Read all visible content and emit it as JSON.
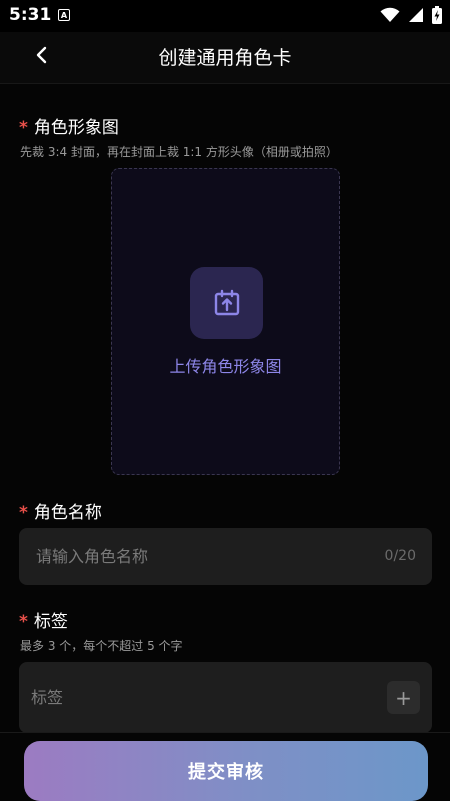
{
  "status_bar": {
    "time": "5:31",
    "app_icon_letter": "A",
    "icons": [
      "wifi-icon",
      "signal-icon",
      "battery-icon"
    ]
  },
  "header": {
    "back_icon": "chevron-left-icon",
    "title": "创建通用角色卡"
  },
  "avatar_section": {
    "required_mark": "*",
    "label": "角色形象图",
    "hint": "先裁 3:4 封面，再在封面上裁 1:1 方形头像（相册或拍照）",
    "upload_icon": "upload-calendar-icon",
    "upload_text": "上传角色形象图"
  },
  "name_section": {
    "required_mark": "*",
    "label": "角色名称",
    "placeholder": "请输入角色名称",
    "value": "",
    "counter": "0/20"
  },
  "tags_section": {
    "required_mark": "*",
    "label": "标签",
    "hint": "最多 3 个，每个不超过 5 个字",
    "placeholder": "标签",
    "add_label": "+"
  },
  "submit": {
    "label": "提交审核"
  },
  "colors": {
    "background": "#050505",
    "required": "#e8504a",
    "accent": "#8d86e8",
    "upload_icon_bg": "#2b2650",
    "input_bg": "#1e1e1e",
    "submit_gradient_start": "#9c7bc2",
    "submit_gradient_end": "#6c97c9"
  }
}
